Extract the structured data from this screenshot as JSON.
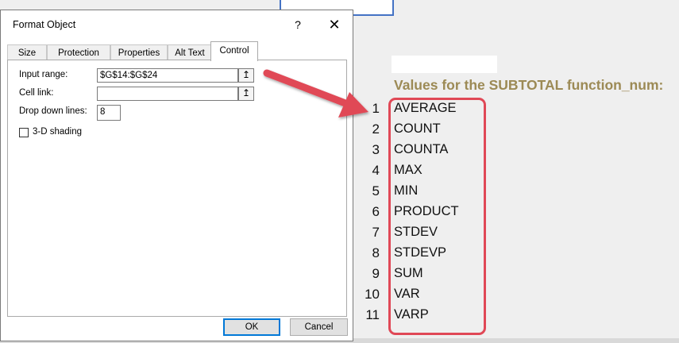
{
  "dialog": {
    "title": "Format Object",
    "help_label": "?",
    "close_label": "✕",
    "tabs": [
      "Size",
      "Protection",
      "Properties",
      "Alt Text",
      "Control"
    ],
    "active_tab": "Control",
    "input_range": {
      "label": "Input range:",
      "value": "$G$14:$G$24"
    },
    "cell_link": {
      "label": "Cell link:",
      "value": ""
    },
    "drop_down_lines": {
      "label": "Drop down lines:",
      "value": "8"
    },
    "three_d_shading": {
      "label": "3-D shading",
      "checked": false
    },
    "ok_label": "OK",
    "cancel_label": "Cancel",
    "collapse_icon": "↥"
  },
  "sheet": {
    "heading": "Values for the SUBTOTAL function_num:",
    "values": [
      {
        "num": "1",
        "name": "AVERAGE"
      },
      {
        "num": "2",
        "name": "COUNT"
      },
      {
        "num": "3",
        "name": "COUNTA"
      },
      {
        "num": "4",
        "name": "MAX"
      },
      {
        "num": "5",
        "name": "MIN"
      },
      {
        "num": "6",
        "name": "PRODUCT"
      },
      {
        "num": "7",
        "name": "STDEV"
      },
      {
        "num": "8",
        "name": "STDEVP"
      },
      {
        "num": "9",
        "name": "SUM"
      },
      {
        "num": "10",
        "name": "VAR"
      },
      {
        "num": "11",
        "name": "VARP"
      }
    ]
  },
  "colors": {
    "heading": "#9c8a55",
    "highlight": "#e04856",
    "ok_border": "#0078d7"
  }
}
